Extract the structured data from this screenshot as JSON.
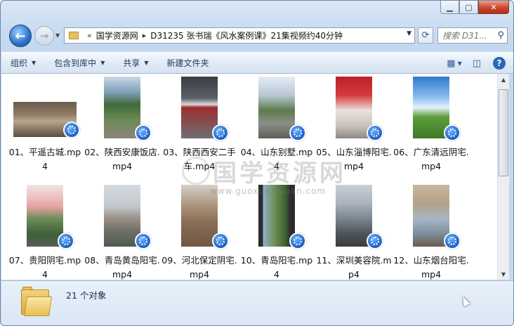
{
  "window": {
    "buttons": {
      "minimize": "▁",
      "maximize": "▢",
      "close": "✕"
    }
  },
  "address": {
    "overflow": "«",
    "crumbs": [
      "国学资源网",
      "D31235 张书瑞《风水案例课》21集视频约40分钟"
    ],
    "separator": "▸"
  },
  "search": {
    "placeholder": "搜索 D31..."
  },
  "toolbar": {
    "organize": "组织",
    "include_library": "包含到库中",
    "share": "共享",
    "new_folder": "新建文件夹"
  },
  "files": [
    {
      "name": "01、平遥古城.mp4",
      "thumb": "courtyard",
      "wide": true
    },
    {
      "name": "02、陕西安康饭店.mp4",
      "thumb": "trees"
    },
    {
      "name": "03、陕西西安二手车.mp4",
      "thumb": "parking"
    },
    {
      "name": "04、山东别墅.mp4",
      "thumb": "villa"
    },
    {
      "name": "05、山东淄博阳宅.mp4",
      "thumb": "red-room"
    },
    {
      "name": "06、广东清远阴宅.mp4",
      "thumb": "sky-field"
    },
    {
      "name": "07、贵阳阴宅.mp4",
      "thumb": "red-text"
    },
    {
      "name": "08、青岛黄岛阳宅.mp4",
      "thumb": "city"
    },
    {
      "name": "09、河北保定阴宅.mp4",
      "thumb": "terrain"
    },
    {
      "name": "10、青岛阳宅.mp4",
      "thumb": "window-view"
    },
    {
      "name": "11、深圳美容院.mp4",
      "thumb": "street"
    },
    {
      "name": "12、山东烟台阳宅.mp4",
      "thumb": "bedroom"
    }
  ],
  "watermark": {
    "text": "国学资源网",
    "url": "www.guoxueziyuan.com"
  },
  "status": {
    "count": "21 个对象"
  }
}
